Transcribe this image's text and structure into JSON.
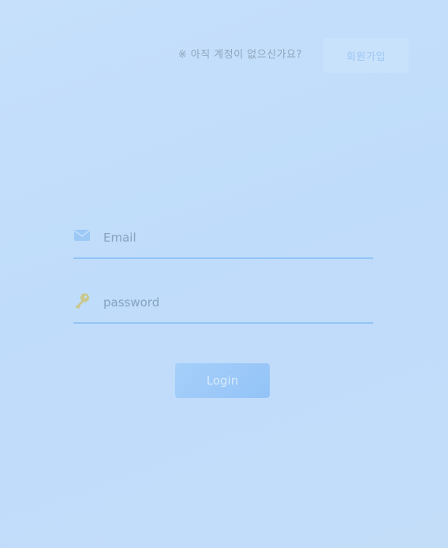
{
  "header": {
    "prompt_text": "※ 아직 계정이 없으신가요?",
    "signup_label": "회원가입"
  },
  "form": {
    "email": {
      "icon": "envelope-icon",
      "placeholder": "Email",
      "value": ""
    },
    "password": {
      "icon": "key-icon",
      "placeholder": "password",
      "value": ""
    },
    "login_label": "Login"
  },
  "colors": {
    "background": "#c2defa",
    "accent": "#93c5f6",
    "key_icon": "#c9c78a",
    "envelope_icon": "#9cc8f6"
  }
}
